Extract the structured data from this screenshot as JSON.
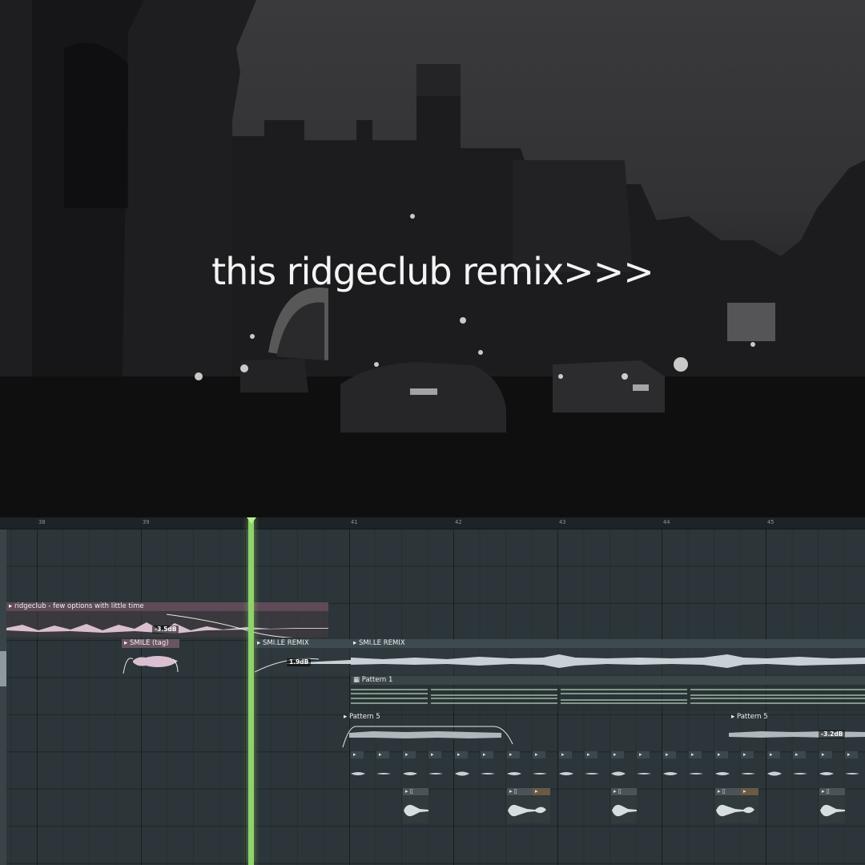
{
  "caption": "this ridgeclub remix>>>",
  "ruler": {
    "bars": [
      "38",
      "39",
      "40",
      "41",
      "42",
      "43",
      "44",
      "45"
    ]
  },
  "clips": {
    "ridgeclub": {
      "label": "ridgeclub - few options with little time",
      "volume": "-3.5dB"
    },
    "smile_tag": {
      "label": "SMILE (tag)"
    },
    "smile_remix_a": {
      "label": "SMI.LE REMIX",
      "volume": "1.9dB"
    },
    "smile_remix_b": {
      "label": "SMI.LE REMIX"
    },
    "pattern1": {
      "label": "Pattern 1"
    },
    "pattern5_a": {
      "label": "Pattern 5"
    },
    "pattern5_b": {
      "label": "Pattern 5",
      "volume": "-3.2dB"
    }
  },
  "colors": {
    "playhead": "#8fd36a",
    "pink_clip": "#c9a6bd",
    "audio_clip": "#5a6a70",
    "pattern_clip": "#445052"
  },
  "icons": {
    "clip_arrow": "play-arrow-icon",
    "pattern": "pattern-icon"
  }
}
